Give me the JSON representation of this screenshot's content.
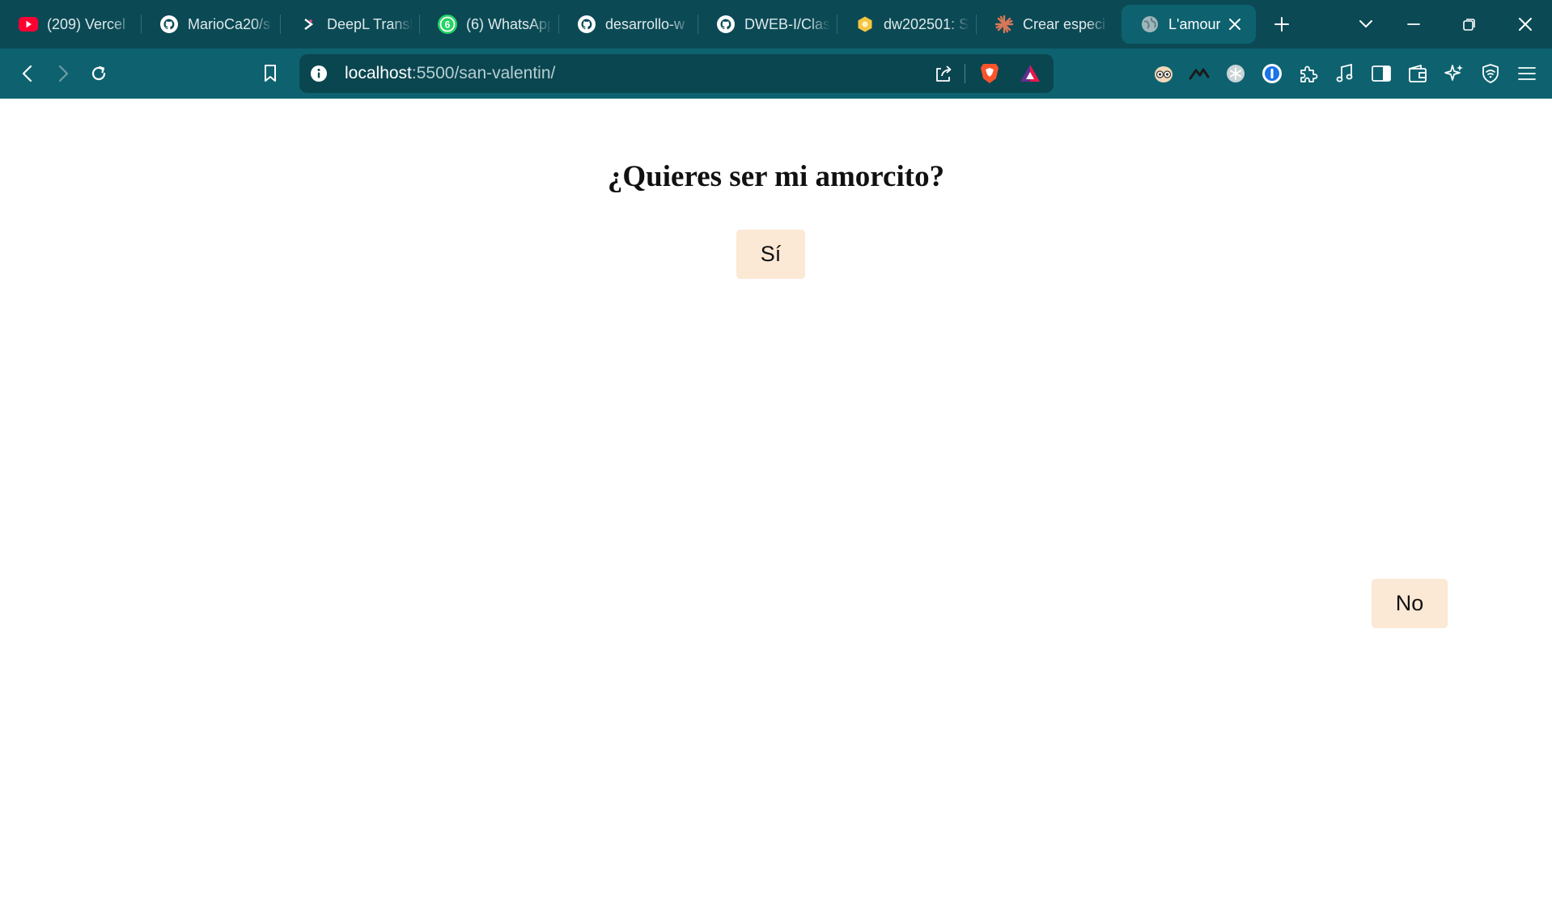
{
  "browser": {
    "tabs": [
      {
        "title": "(209) Vercel",
        "icon": "youtube-icon"
      },
      {
        "title": "MarioCa20/s",
        "icon": "github-icon"
      },
      {
        "title": "DeepL Transl",
        "icon": "deepl-icon"
      },
      {
        "title": "(6) WhatsApp",
        "icon": "whatsapp-icon",
        "badge": "6"
      },
      {
        "title": "desarrollo-w",
        "icon": "github-icon"
      },
      {
        "title": "DWEB-I/Clas",
        "icon": "github-icon"
      },
      {
        "title": "dw202501: S",
        "icon": "moodle-icon"
      },
      {
        "title": "Crear especi",
        "icon": "claude-icon"
      },
      {
        "title": "L'amour",
        "icon": "globe-icon",
        "active": true
      }
    ],
    "url": {
      "host": "localhost",
      "rest": ":5500/san-valentin/"
    },
    "colors": {
      "tabstrip": "#0b4a55",
      "toolbar": "#0e6270",
      "urlbar": "#0a4650"
    }
  },
  "page": {
    "question": "¿Quieres ser mi amorcito?",
    "yes_label": "Sí",
    "no_label": "No",
    "button_color": "#fbe8d5"
  }
}
